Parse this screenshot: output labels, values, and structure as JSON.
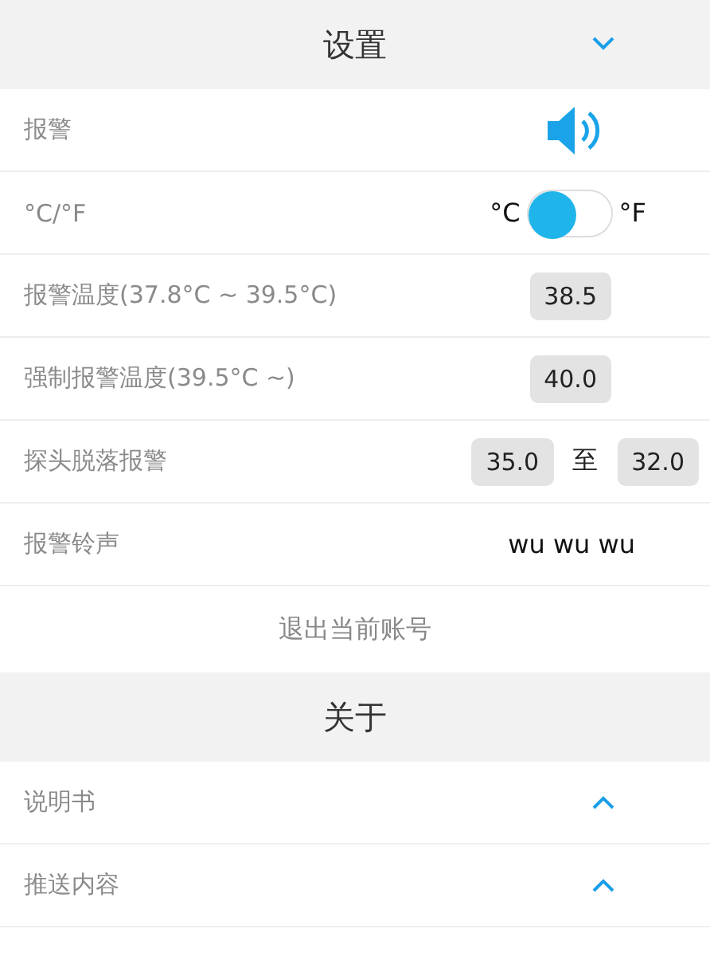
{
  "settings": {
    "title": "设置",
    "expanded": true,
    "rows": [
      {
        "kind": "sound",
        "label": "报警",
        "on": true
      },
      {
        "kind": "toggle",
        "label": "°C/°F",
        "left": "°C",
        "right": "°F",
        "on": false
      },
      {
        "kind": "value",
        "label": "报警温度(37.8°C ~ 39.5°C)",
        "value": "38.5"
      },
      {
        "kind": "value",
        "label": "强制报警温度(39.5°C ~)",
        "value": "40.0"
      },
      {
        "kind": "range",
        "label": "探头脱落报警",
        "from": "35.0",
        "sep": "至",
        "to": "32.0"
      },
      {
        "kind": "text",
        "label": "报警铃声",
        "value": "wu wu wu"
      }
    ],
    "logout": "退出当前账号"
  },
  "about": {
    "title": "关于",
    "rows": [
      {
        "label": "说明书",
        "expanded": false
      },
      {
        "label": "推送内容",
        "expanded": false
      }
    ]
  }
}
